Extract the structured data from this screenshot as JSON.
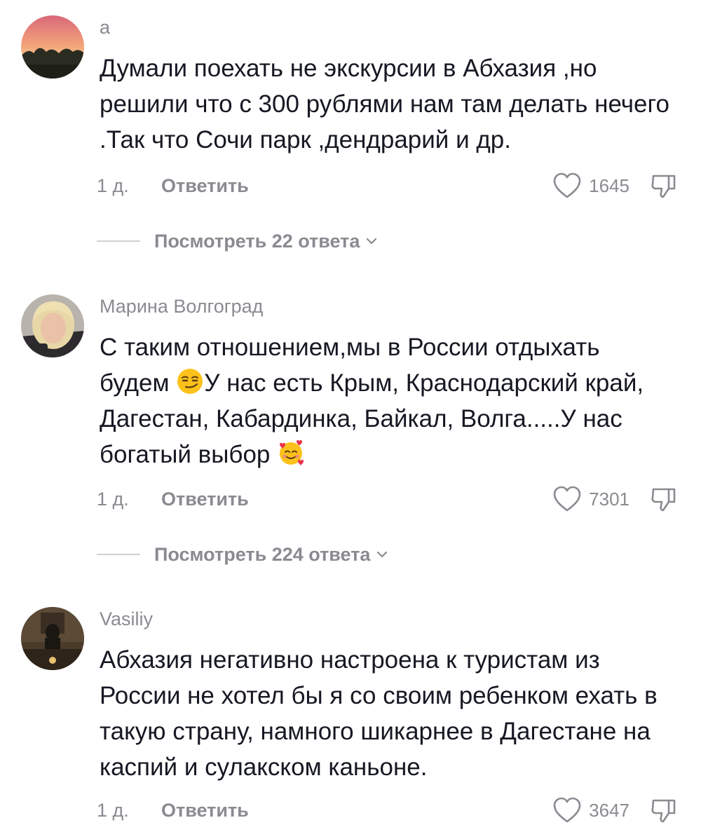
{
  "comments": [
    {
      "username": "а",
      "text": "Думали поехать не экскурсии в Абхазия ,но решили что с 300 рублями нам там делать нечего .Так что Сочи парк ,дендрарий и др.",
      "time": "1 д.",
      "reply_label": "Ответить",
      "likes": "1645",
      "view_replies": "Посмотреть 22 ответа"
    },
    {
      "username": "Марина Волгоград",
      "text_part1": "С таким отношением,мы в России отдыхать будем ",
      "text_part2": "У нас есть Крым, Краснодарский край, Дагестан, Кабардинка, Байкал, Волга.....У нас богатый выбор ",
      "emoji1": "smirk-emoji",
      "emoji2": "smiling-face-with-hearts-emoji",
      "time": "1 д.",
      "reply_label": "Ответить",
      "likes": "7301",
      "view_replies": "Посмотреть 224 ответа"
    },
    {
      "username": "Vasiliy",
      "text": "Абхазия негативно настроена к туристам из России не хотел бы я со своим ребенком ехать в такую страну, намного шикарнее в Дагестане на каспий и сулакском каньоне.",
      "time": "1 д.",
      "reply_label": "Ответить",
      "likes": "3647"
    }
  ],
  "colors": {
    "text": "#161823",
    "secondary": "#8a8b91",
    "divider": "#d0d1d3"
  },
  "icons": {
    "like": "heart-outline-icon",
    "dislike": "thumbs-down-icon",
    "expand": "chevron-down-icon"
  }
}
